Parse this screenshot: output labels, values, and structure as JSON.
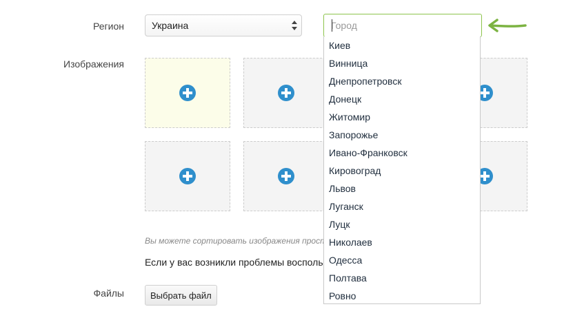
{
  "form": {
    "region_label": "Регион",
    "region_value": "Украина",
    "city_placeholder": "Город",
    "images_label": "Изображения",
    "images_hint": "Вы можете сортировать изображения прост",
    "problem_text": "Если у вас возникли проблемы восполь",
    "files_label": "Файлы",
    "file_button": "Выбрать файл"
  },
  "cities": [
    "Киев",
    "Винница",
    "Днепропетровск",
    "Донецк",
    "Житомир",
    "Запорожье",
    "Ивано-Франковск",
    "Кировоград",
    "Львов",
    "Луганск",
    "Луцк",
    "Николаев",
    "Одесса",
    "Полтава",
    "Ровно"
  ],
  "colors": {
    "accent_green": "#7cb342",
    "plus_blue": "#2f8fcc",
    "active_tile": "#fcfde9"
  },
  "icons": {
    "arrow": "left-arrow-icon",
    "plus": "plus-circle-icon",
    "select_arrows": "up-down-arrows-icon"
  }
}
